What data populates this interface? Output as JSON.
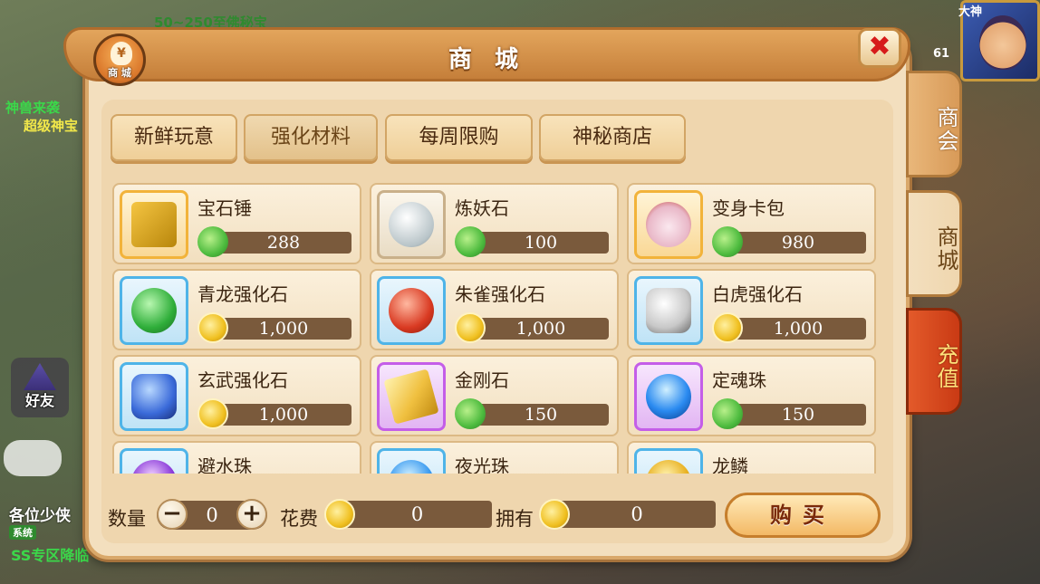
{
  "background": {
    "top_text": "50~250至佛秘宝",
    "left_text_1": "神兽来袭",
    "left_text_2": "超级神宝",
    "player_name": "大神",
    "player_level": "61",
    "friend_label": "好友",
    "chat_1": "各位少侠",
    "chat_tag": "系统",
    "chat_2": "SS专区降临"
  },
  "window": {
    "title": "商 城",
    "emblem_label": "商 城",
    "emblem_icon": "¥",
    "close_label": "✖"
  },
  "categories": [
    {
      "label": "新鲜玩意",
      "active": false
    },
    {
      "label": "强化材料",
      "active": true
    },
    {
      "label": "每周限购",
      "active": false
    },
    {
      "label": "神秘商店",
      "active": false
    }
  ],
  "items": [
    {
      "name": "宝石锤",
      "price": "288",
      "currency": "jade-icon",
      "frame": "gold"
    },
    {
      "name": "炼妖石",
      "price": "100",
      "currency": "jade-icon",
      "frame": "plain"
    },
    {
      "name": "变身卡包",
      "price": "980",
      "currency": "jade-icon",
      "frame": "gold"
    },
    {
      "name": "青龙强化石",
      "price": "1,000",
      "currency": "gold-coin-icon",
      "frame": "blue"
    },
    {
      "name": "朱雀强化石",
      "price": "1,000",
      "currency": "gold-coin-icon",
      "frame": "blue"
    },
    {
      "name": "白虎强化石",
      "price": "1,000",
      "currency": "gold-coin-icon",
      "frame": "blue"
    },
    {
      "name": "玄武强化石",
      "price": "1,000",
      "currency": "gold-coin-icon",
      "frame": "blue"
    },
    {
      "name": "金刚石",
      "price": "150",
      "currency": "jade-icon",
      "frame": "purple"
    },
    {
      "name": "定魂珠",
      "price": "150",
      "currency": "jade-icon",
      "frame": "purple"
    },
    {
      "name": "避水珠",
      "price": "",
      "currency": "",
      "frame": "blue"
    },
    {
      "name": "夜光珠",
      "price": "",
      "currency": "",
      "frame": "blue"
    },
    {
      "name": "龙鳞",
      "price": "",
      "currency": "",
      "frame": "blue"
    }
  ],
  "purchase": {
    "quantity_label": "数量",
    "quantity_value": "0",
    "minus_label": "−",
    "plus_label": "+",
    "cost_label": "花费",
    "cost_value": "0",
    "owned_label": "拥有",
    "owned_value": "0",
    "buy_label": "购买"
  },
  "side_tabs": {
    "guild": "商会",
    "shop": "商城",
    "recharge": "充值"
  },
  "colors": {
    "panel_bg": "#f3dfbe",
    "title_bar": "#d08a44",
    "price_bar": "#7a5a3c",
    "close_red": "#d61a1a",
    "recharge_red": "#d4441e"
  }
}
